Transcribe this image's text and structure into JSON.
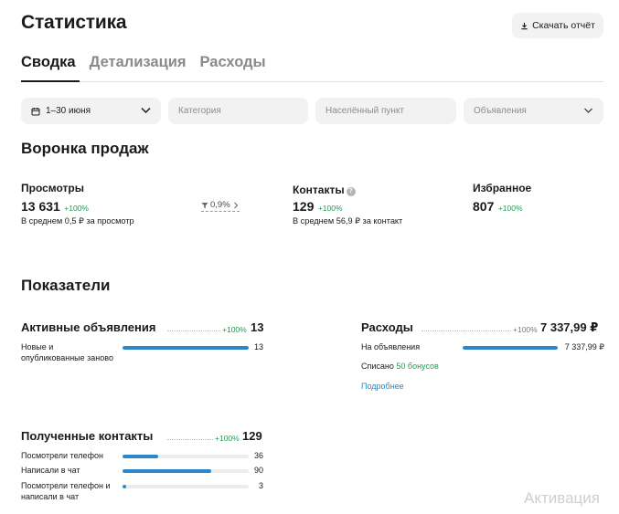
{
  "header": {
    "title": "Статистика",
    "download_label": "Скачать отчёт"
  },
  "tabs": [
    {
      "label": "Сводка",
      "active": true
    },
    {
      "label": "Детализация",
      "active": false
    },
    {
      "label": "Расходы",
      "active": false
    }
  ],
  "filters": {
    "date": "1–30 июня",
    "category_placeholder": "Категория",
    "locality_placeholder": "Населённый пункт",
    "ads": "Объявления"
  },
  "funnel": {
    "title": "Воронка продаж",
    "views": {
      "label": "Просмотры",
      "value": "13 631",
      "delta": "+100%",
      "note": "В среднем 0,5 ₽ за просмотр"
    },
    "conversion": "0,9%",
    "contacts": {
      "label": "Контакты",
      "help": "?",
      "value": "129",
      "delta": "+100%",
      "note": "В среднем 56,9 ₽ за контакт"
    },
    "favorites": {
      "label": "Избранное",
      "value": "807",
      "delta": "+100%"
    }
  },
  "indicators": {
    "title": "Показатели",
    "active_ads": {
      "label": "Активные объявления",
      "delta": "+100%",
      "value": "13",
      "rows": [
        {
          "label": "Новые и опубликованные заново",
          "value": "13",
          "fraction": 1.0
        }
      ]
    },
    "expenses": {
      "label": "Расходы",
      "delta": "+100%",
      "value": "7 337,99 ₽",
      "rows": [
        {
          "label": "На объявления",
          "value": "7 337,99 ₽",
          "fraction": 1.0
        }
      ],
      "written_off_prefix": "Списано",
      "bonus": "50 бонусов",
      "more_link": "Подробнее"
    },
    "contacts": {
      "label": "Полученные контакты",
      "delta": "+100%",
      "value": "129",
      "rows": [
        {
          "label": "Посмотрели телефон",
          "value": "36",
          "fraction": 0.28
        },
        {
          "label": "Написали в чат",
          "value": "90",
          "fraction": 0.7
        },
        {
          "label": "Посмотрели телефон и написали в чат",
          "value": "3",
          "fraction": 0.03
        }
      ]
    }
  },
  "watermark": "Активация",
  "colors": {
    "accent_green": "#1e9e4f",
    "bar_blue": "#2a86c8",
    "filter_bg": "#f2f2f2"
  }
}
